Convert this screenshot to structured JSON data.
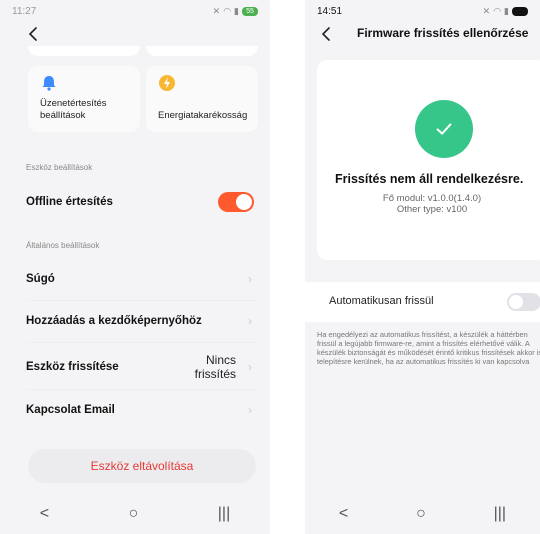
{
  "left": {
    "status": {
      "time": "11:27",
      "battery": "55"
    },
    "tiles": [
      {
        "label_line1": "Üzenetértesítés",
        "label_line2": "beállítások"
      },
      {
        "label_line1": "Energiatakarékosság",
        "label_line2": ""
      }
    ],
    "device_settings_title": "Eszköz beállítások",
    "offline_label": "Offline értesítés",
    "offline_enabled": true,
    "general_settings_title": "Általános beállítások",
    "rows": {
      "help": "Súgó",
      "add_home": "Hozzáadás a kezdőképernyőhöz",
      "update": "Eszköz frissítése",
      "update_value_line1": "Nincs",
      "update_value_line2": "frissítés",
      "email": "Kapcsolat Email"
    },
    "remove_button": "Eszköz eltávolítása",
    "colors": {
      "accent": "#ff5a2d",
      "danger": "#e53935"
    }
  },
  "right": {
    "status": {
      "time": "14:51"
    },
    "title": "Firmware frissítés ellenőrzése",
    "status_text": "Frissítés nem áll rendelkezésre.",
    "main_module": "Fő modul: v1.0.0(1.4.0)",
    "other_type": "Other type: v100",
    "auto_update_label": "Automatikusan frissül",
    "auto_update_enabled": false,
    "description": "Ha engedélyezi az automatikus frissítést, a készülék a háttérben frissül a legújabb firmware-re, amint a frissítés elérhetővé válik. A készülék biztonságát és működését érintő kritikus frissítések akkor is telepítésre kerülnek, ha az automatikus frissítés ki van kapcsolva",
    "colors": {
      "success": "#36c68a"
    }
  },
  "navbar": {
    "back": "<",
    "home": "○",
    "recents": "|||"
  }
}
